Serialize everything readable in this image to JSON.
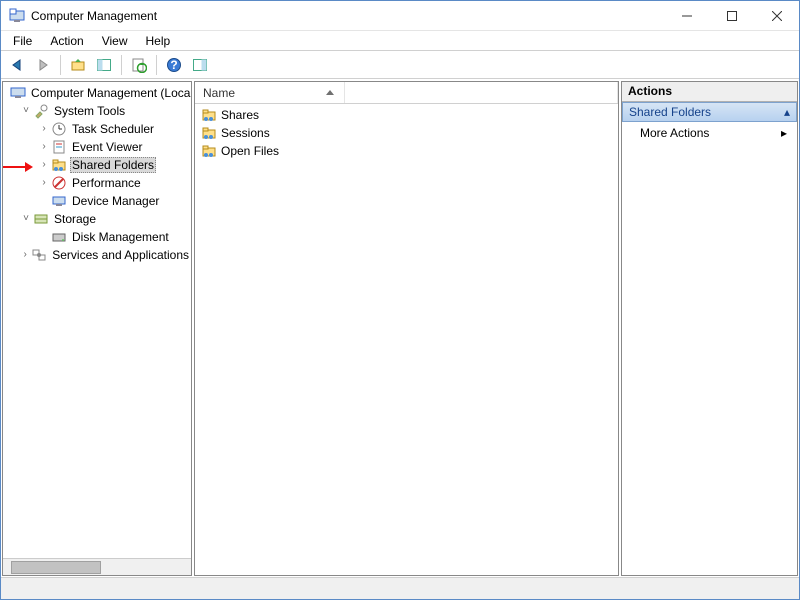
{
  "window": {
    "title": "Computer Management"
  },
  "menus": {
    "file": "File",
    "action": "Action",
    "view": "View",
    "help": "Help"
  },
  "tree": {
    "root": "Computer Management (Local)",
    "system_tools": "System Tools",
    "task_scheduler": "Task Scheduler",
    "event_viewer": "Event Viewer",
    "shared_folders": "Shared Folders",
    "performance": "Performance",
    "device_manager": "Device Manager",
    "storage": "Storage",
    "disk_management": "Disk Management",
    "services_apps": "Services and Applications"
  },
  "columns": {
    "name": "Name"
  },
  "items": {
    "shares": "Shares",
    "sessions": "Sessions",
    "open_files": "Open Files"
  },
  "actions": {
    "header": "Actions",
    "section": "Shared Folders",
    "more": "More Actions"
  }
}
